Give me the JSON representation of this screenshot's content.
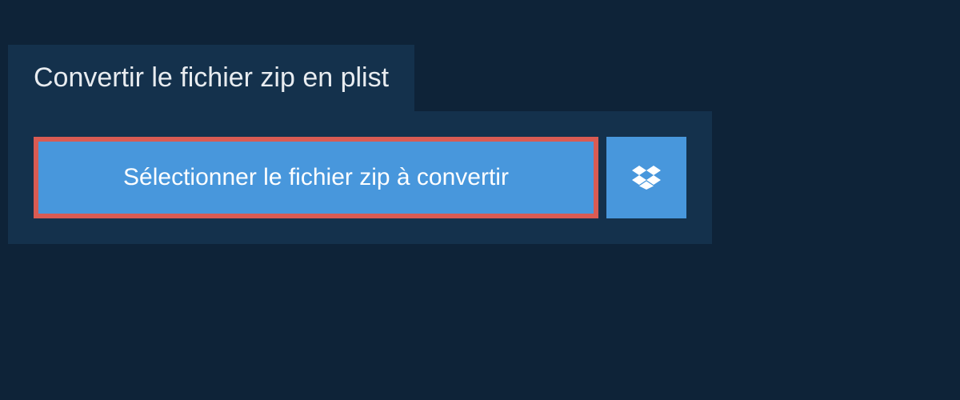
{
  "header": {
    "title": "Convertir le fichier zip en plist"
  },
  "actions": {
    "selectFileLabel": "Sélectionner le fichier zip à convertir"
  }
}
